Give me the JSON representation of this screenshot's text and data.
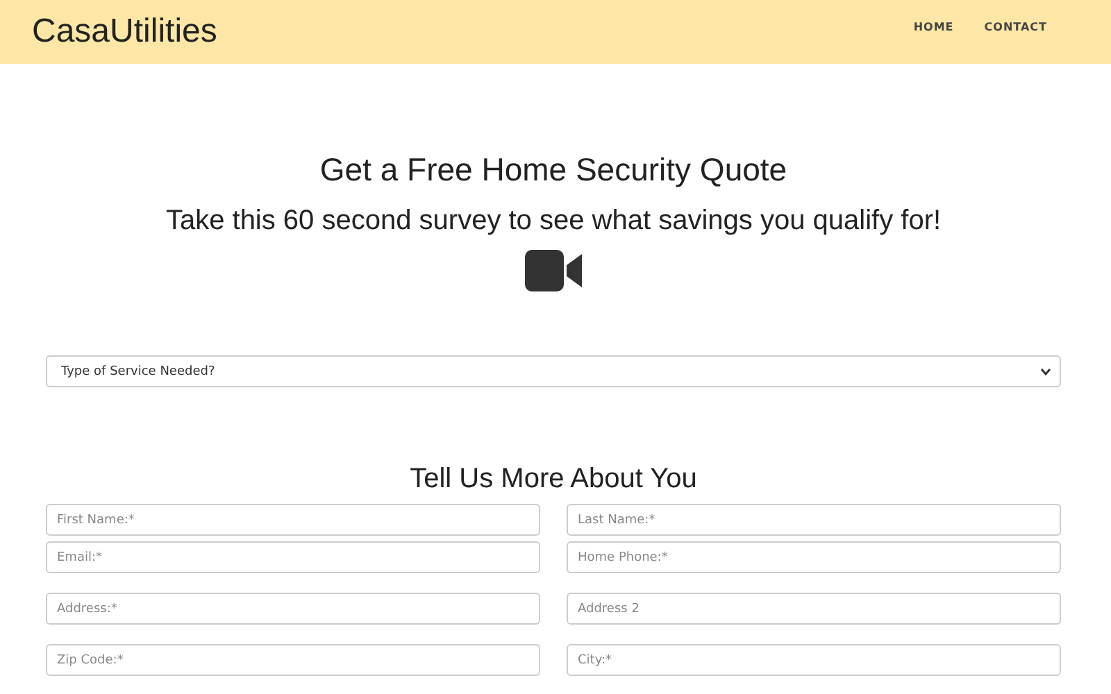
{
  "header": {
    "logo": "CasaUtilities",
    "nav": [
      {
        "label": "HOME"
      },
      {
        "label": "CONTACT"
      }
    ]
  },
  "hero": {
    "title": "Get a Free Home Security Quote",
    "subtitle": "Take this 60 second survey to see what savings you qualify for!"
  },
  "service_select": {
    "placeholder": "Type of Service Needed?"
  },
  "section_title": "Tell Us More About You",
  "field_rows": [
    {
      "fields": [
        {
          "placeholder": "First Name:*"
        },
        {
          "placeholder": "Last Name:*"
        }
      ]
    },
    {
      "fields": [
        {
          "placeholder": "Email:*"
        },
        {
          "placeholder": "Home Phone:*"
        }
      ]
    },
    {
      "fields": [
        {
          "placeholder": "Address:*"
        },
        {
          "placeholder": "Address 2"
        }
      ]
    },
    {
      "fields": [
        {
          "placeholder": "Zip Code:*"
        },
        {
          "placeholder": "City:*"
        }
      ]
    }
  ]
}
